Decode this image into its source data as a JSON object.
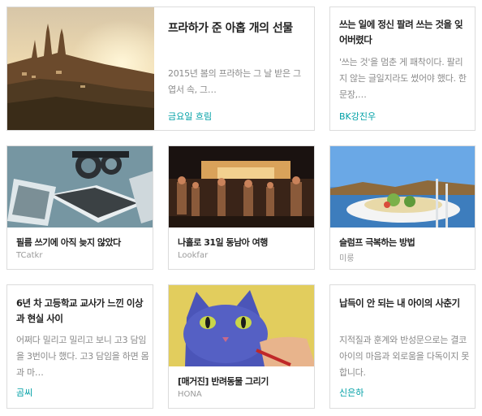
{
  "featured": {
    "title": "프라하가 준 아홉 개의 선물",
    "excerpt": "2015년 봄의 프라하는 그 날 받은 그 엽서 속, 그…",
    "author": "금요일 흐림"
  },
  "top_right": {
    "title": "쓰는 일에 정신 팔려 쓰는 것을 잊어버렸다",
    "excerpt": "'쓰는 것'을 멈춘 게 패착이다. 팔리지 않는 글일지라도 썼어야 했다. 한 문장,…",
    "author": "BK강진우"
  },
  "row2": [
    {
      "title": "필름 쓰기에 아직 늦지 않았다",
      "author": "TCatkr"
    },
    {
      "title": "나홀로 31일 동남아 여행",
      "author": "Lookfar"
    },
    {
      "title": "슬럼프 극복하는 방법",
      "author": "미룽"
    }
  ],
  "row3": {
    "left": {
      "title": "6년 차 고등학교 교사가 느낀 이상과 현실 사이",
      "excerpt": "어쩌다 밀리고 밀리고 보니 고3 담임을 3번이나 했다. 고3 담임을 하면 몸과 마…",
      "author": "곰씨"
    },
    "middle": {
      "title": "[매거진] 반려동물 그리기",
      "author": "HONA"
    },
    "right": {
      "title": "납득이 안 되는 내 아이의 사춘기",
      "excerpt": "지적질과 훈계와 반성문으로는 결코 아이의 마음과 외로움을 다독이지 못합니다.",
      "author": "신은하"
    }
  },
  "colors": {
    "accent": "#00a0a6",
    "border": "#dcdcdc"
  }
}
